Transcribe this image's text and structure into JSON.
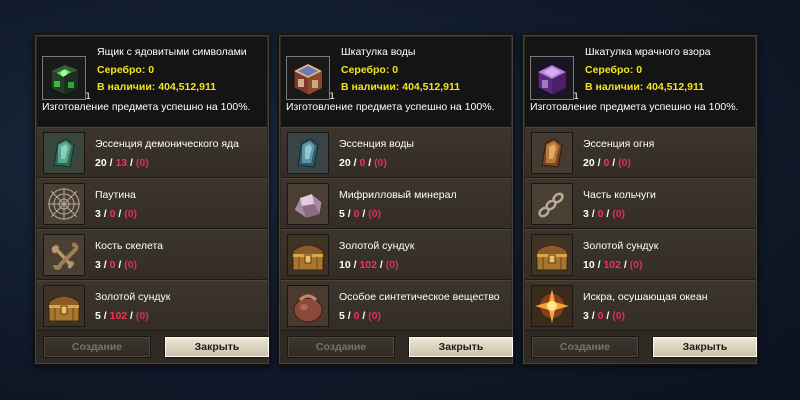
{
  "panels": [
    {
      "title": "Ящик с ядовитыми символами",
      "silver": "Серебро: 0",
      "stock": "В наличии: 404,512,911",
      "message": "Изготовление предмета успешно на 100%.",
      "quantity": "1",
      "icon": "poison-crate-icon",
      "materials": [
        {
          "name": "Эссенция демонического яда",
          "have": "20",
          "need": "13",
          "extra": "(0)",
          "icon": "poison-essence-icon"
        },
        {
          "name": "Паутина",
          "have": "3",
          "need": "0",
          "extra": "(0)",
          "icon": "spiderweb-icon"
        },
        {
          "name": "Кость скелета",
          "have": "3",
          "need": "0",
          "extra": "(0)",
          "icon": "bone-icon"
        },
        {
          "name": "Золотой сундук",
          "have": "5",
          "need": "102",
          "extra": "(0)",
          "icon": "golden-chest-icon"
        }
      ],
      "buttons": {
        "create": "Создание",
        "close": "Закрыть"
      }
    },
    {
      "title": "Шкатулка воды",
      "silver": "Серебро: 0",
      "stock": "В наличии: 404,512,911",
      "message": "Изготовление предмета успешно на 100%.",
      "quantity": "1",
      "icon": "water-casket-icon",
      "materials": [
        {
          "name": "Эссенция воды",
          "have": "20",
          "need": "0",
          "extra": "(0)",
          "icon": "water-essence-icon"
        },
        {
          "name": "Мифрилловый минерал",
          "have": "5",
          "need": "0",
          "extra": "(0)",
          "icon": "mithril-ore-icon"
        },
        {
          "name": "Золотой сундук",
          "have": "10",
          "need": "102",
          "extra": "(0)",
          "icon": "golden-chest-icon"
        },
        {
          "name": "Особое синтетическое вещество",
          "have": "5",
          "need": "0",
          "extra": "(0)",
          "icon": "synthetic-pouch-icon"
        }
      ],
      "buttons": {
        "create": "Создание",
        "close": "Закрыть"
      }
    },
    {
      "title": "Шкатулка мрачного взора",
      "silver": "Серебро: 0",
      "stock": "В наличии: 404,512,911",
      "message": "Изготовление предмета успешно на 100%.",
      "quantity": "1",
      "icon": "gloom-casket-icon",
      "materials": [
        {
          "name": "Эссенция огня",
          "have": "20",
          "need": "0",
          "extra": "(0)",
          "icon": "fire-essence-icon"
        },
        {
          "name": "Часть кольчуги",
          "have": "3",
          "need": "0",
          "extra": "(0)",
          "icon": "chainmail-piece-icon"
        },
        {
          "name": "Золотой сундук",
          "have": "10",
          "need": "102",
          "extra": "(0)",
          "icon": "golden-chest-icon"
        },
        {
          "name": "Искра, осушающая океан",
          "have": "3",
          "need": "0",
          "extra": "(0)",
          "icon": "ocean-spark-icon"
        }
      ],
      "buttons": {
        "create": "Создание",
        "close": "Закрыть"
      }
    }
  ],
  "colors": {
    "gold_text": "#f5e31e",
    "red_count": "#f0345a",
    "panel_bg": "#2f2a24",
    "header_bg": "#141414"
  }
}
